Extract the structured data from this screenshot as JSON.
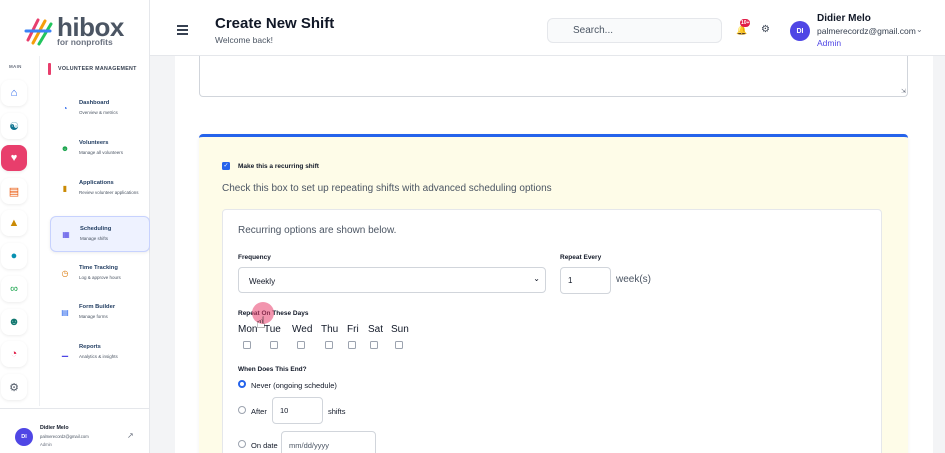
{
  "brand": {
    "name": "hibox",
    "tagline": "for nonprofits"
  },
  "sidebar": {
    "rail_label": "MAIN",
    "section_title": "VOLUNTEER MANAGEMENT",
    "items": [
      {
        "title": "Dashboard",
        "subtitle": "Overview & metrics"
      },
      {
        "title": "Volunteers",
        "subtitle": "Manage all volunteers"
      },
      {
        "title": "Applications",
        "subtitle": "Review volunteer applications"
      },
      {
        "title": "Scheduling",
        "subtitle": "Manage shifts"
      },
      {
        "title": "Time Tracking",
        "subtitle": "Log & approve hours"
      },
      {
        "title": "Form Builder",
        "subtitle": "Manage forms"
      },
      {
        "title": "Reports",
        "subtitle": "Analytics & insights"
      }
    ],
    "user": {
      "initials": "DI",
      "name": "Didier Melo",
      "email": "palmerecordz@gmail.com",
      "role": "Admin"
    }
  },
  "header": {
    "title": "Create New Shift",
    "subtitle": "Welcome back!",
    "search_placeholder": "Search...",
    "notification_count": "10+",
    "user": {
      "initials": "DI",
      "name": "Didier Melo",
      "email": "palmerecordz@gmail.com",
      "role": "Admin"
    }
  },
  "recurring": {
    "checkbox_label": "Make this a recurring shift",
    "checked": true,
    "help": "Check this box to set up repeating shifts with advanced scheduling options",
    "intro": "Recurring options are shown below.",
    "frequency_label": "Frequency",
    "frequency_value": "Weekly",
    "repeat_every_label": "Repeat Every",
    "repeat_every_value": "1",
    "repeat_every_unit": "week(s)",
    "days_label": "Repeat On These Days",
    "days": [
      "Mon",
      "Tue",
      "Wed",
      "Thu",
      "Fri",
      "Sat",
      "Sun"
    ],
    "end_label": "When Does This End?",
    "end_never": "Never (ongoing schedule)",
    "end_after": "After",
    "end_after_value": "10",
    "end_after_unit": "shifts",
    "end_on_date": "On date",
    "date_placeholder": "mm/dd/yyyy"
  },
  "colors": {
    "accent": "#e83e6c",
    "primary": "#2563eb",
    "card_bg": "#fefce8"
  }
}
